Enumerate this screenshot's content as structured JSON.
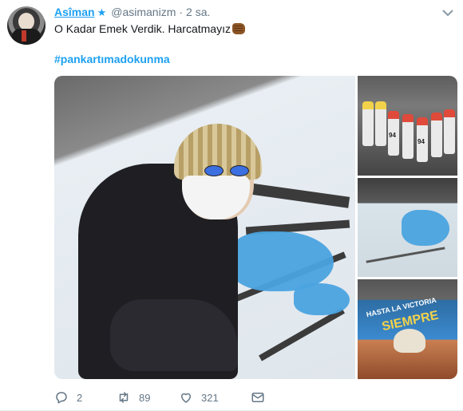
{
  "tweet": {
    "author_name": "Asîman",
    "author_star": "★",
    "handle": "@asimanizm",
    "separator": "·",
    "time": "2 sa.",
    "text": "O Kadar Emek Verdik. Harcatmayız",
    "hashtag": "#pankartımadokunma",
    "can_label": "94",
    "banner_text_1": "HASTA LA VICTORIA",
    "banner_text_2": "SIEMPRE"
  },
  "actions": {
    "reply_count": "2",
    "retweet_count": "89",
    "like_count": "321"
  },
  "colors": {
    "accent": "#1da1f2",
    "muted": "#657786",
    "text": "#14171a"
  },
  "icons": {
    "menu": "chevron-down-icon",
    "reply": "reply-icon",
    "retweet": "retweet-icon",
    "like": "heart-icon",
    "message": "envelope-icon",
    "emoji": "fist-emoji-icon"
  }
}
